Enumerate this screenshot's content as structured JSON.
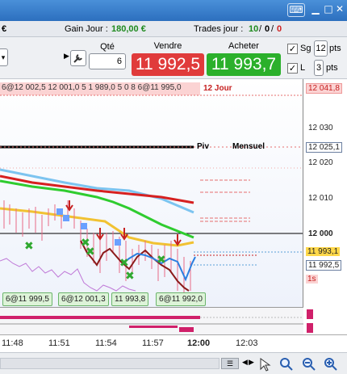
{
  "infobar": {
    "currency_symbol": "€",
    "gain_label": "Gain Jour :",
    "gain_value": "180,00 €",
    "trades_label": "Trades jour :",
    "trades_wins": "10",
    "trades_sep1": "/",
    "trades_zero": "0",
    "trades_sep2": "/",
    "trades_losses": "0"
  },
  "order": {
    "qty_label": "Qté",
    "qty_value": "6",
    "sell_label": "Vendre",
    "sell_price": "11 992,5",
    "buy_label": "Acheter",
    "buy_price": "11 993,7",
    "sg_label": "Sg",
    "sg_value": "12",
    "pts_label": "pts",
    "l_label": "L",
    "l_value": "3",
    "pts_label2": "pts",
    "colors": {
      "sell": "#e03b3b",
      "buy": "#2bb02b"
    }
  },
  "chart": {
    "top_order_text": "6@12 002,5 12 001,0 5 1 989,0 5 0 8 6@11 995,0",
    "top_jour_label": "12 Jour",
    "piv_label": "Piv",
    "mensuel_label": "Mensuel",
    "bottom_orders": [
      "6@11 999,5",
      "6@12 001,3",
      "11 993,8",
      "6@11 992,0"
    ],
    "yaxis": {
      "labels": [
        "12 041,8",
        "12 030",
        "12 025,1",
        "12 020",
        "12 010",
        "12 000",
        "11 993,1",
        "11 992,5",
        "1s"
      ]
    },
    "xaxis": {
      "labels": [
        "11:48",
        "11:51",
        "11:54",
        "11:57",
        "12:00",
        "12:03"
      ]
    }
  }
}
